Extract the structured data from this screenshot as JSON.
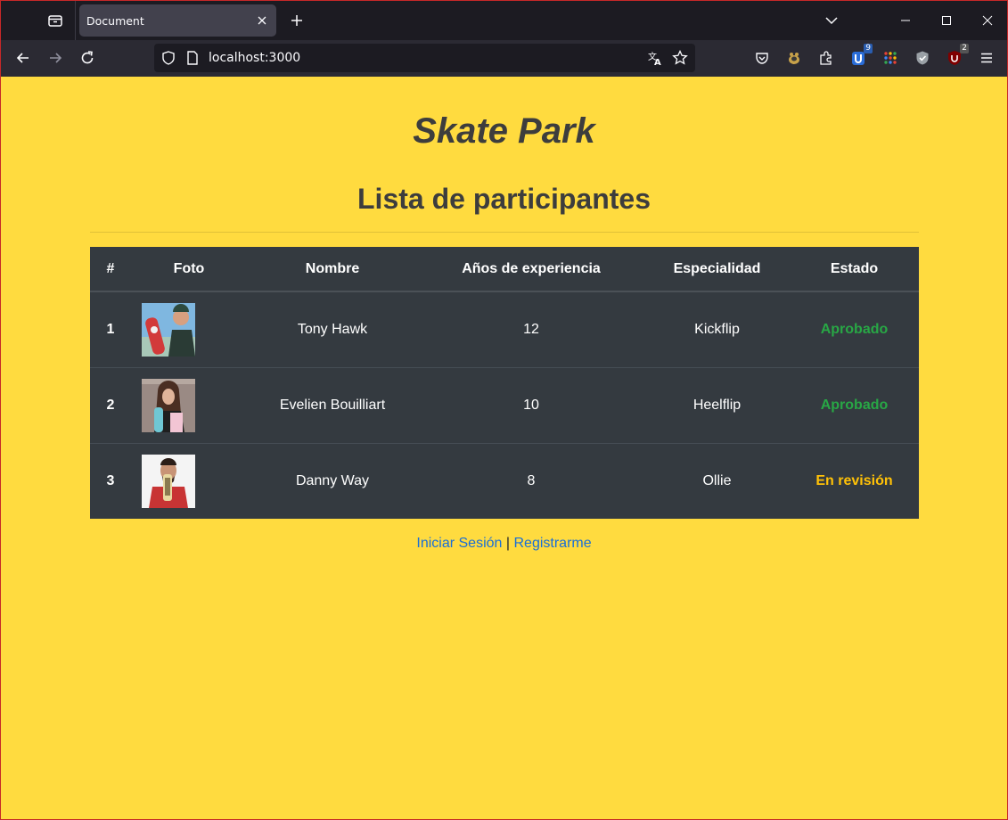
{
  "browser": {
    "tab_title": "Document",
    "url": "localhost:3000",
    "extensions": [
      {
        "name": "pocket-icon"
      },
      {
        "name": "extension-icon-1"
      },
      {
        "name": "puzzle-icon"
      },
      {
        "name": "ublock-icon",
        "badge": "9"
      },
      {
        "name": "apps-grid-icon"
      },
      {
        "name": "shield-extension-icon"
      },
      {
        "name": "ublock-origin-icon",
        "badge": "2"
      }
    ]
  },
  "page": {
    "title": "Skate Park",
    "subtitle": "Lista de participantes"
  },
  "table": {
    "headers": [
      "#",
      "Foto",
      "Nombre",
      "Años de experiencia",
      "Especialidad",
      "Estado"
    ],
    "rows": [
      {
        "num": "1",
        "nombre": "Tony Hawk",
        "experiencia": "12",
        "especialidad": "Kickflip",
        "estado": "Aprobado",
        "estado_color": "#28a745"
      },
      {
        "num": "2",
        "nombre": "Evelien Bouilliart",
        "experiencia": "10",
        "especialidad": "Heelflip",
        "estado": "Aprobado",
        "estado_color": "#28a745"
      },
      {
        "num": "3",
        "nombre": "Danny Way",
        "experiencia": "8",
        "especialidad": "Ollie",
        "estado": "En revisión",
        "estado_color": "#ffc107"
      }
    ]
  },
  "footer": {
    "login_label": "Iniciar Sesión",
    "separator": "|",
    "register_label": "Registrarme"
  },
  "colors": {
    "background": "#ffdb3f",
    "table_bg": "#343a40",
    "link": "#1a6fd6"
  }
}
